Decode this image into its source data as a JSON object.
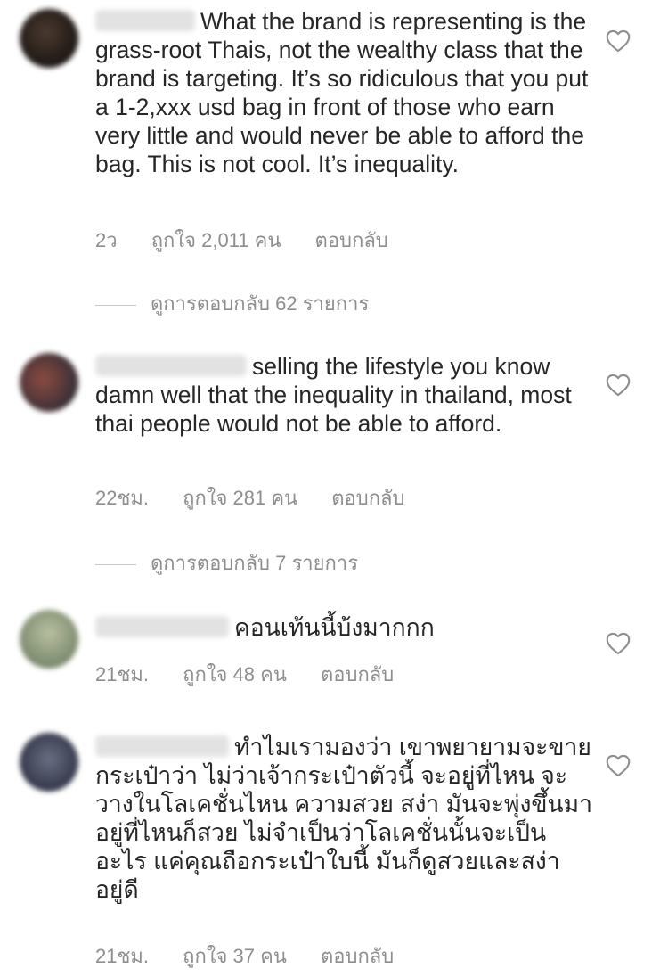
{
  "comments": [
    {
      "text": "What the brand is representing is the grass-root Thais, not the wealthy class that the brand is targeting. It’s so ridiculous that you put a 1-2,xxx usd bag in front of those who earn very little and would never be able to afford the bag. This is not cool. It’s inequality.",
      "time": "2ว",
      "likes": "ถูกใจ 2,011 คน",
      "reply": "ตอบกลับ",
      "view_replies": "ดูการตอบกลับ 62 รายการ"
    },
    {
      "text": "selling the lifestyle you know damn well that the inequality in thailand, most thai people would not be able to afford.",
      "time": "22ชม.",
      "likes": "ถูกใจ 281 คน",
      "reply": "ตอบกลับ",
      "view_replies": "ดูการตอบกลับ 7 รายการ"
    },
    {
      "text": "คอนเท้นนี้บ้งมากกก",
      "time": "21ชม.",
      "likes": "ถูกใจ 48 คน",
      "reply": "ตอบกลับ"
    },
    {
      "text": "ทำไมเรามองว่า เขาพยายามจะขายกระเป๋าว่า ไม่ว่าเจ้ากระเป๋าตัวนี้ จะอยู่ที่ไหน จะวางในโลเคชั่นไหน ความสวย สง่า มันจะพุ่งขึ้นมา อยู่ที่ไหนก็สวย ไม่จำเป็นว่าโลเคชั่นนั้นจะเป็นอะไร แค่คุณถือกระเป๋าใบนี้ มันก็ดูสวยและสง่าอยู่ดี",
      "time": "21ชม.",
      "likes": "ถูกใจ 37 คน",
      "reply": "ตอบกลับ"
    }
  ],
  "colors": {
    "text": "#262626",
    "secondary": "#8e8e8e",
    "divider": "#c7c7c7"
  },
  "icons": {
    "like": "heart-outline-icon"
  }
}
